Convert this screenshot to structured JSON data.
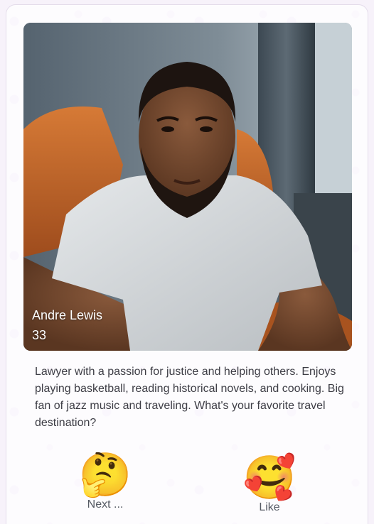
{
  "profile": {
    "name": "Andre Lewis",
    "age": "33",
    "bio": "Lawyer with a passion for justice and helping others. Enjoys playing basketball, reading historical novels, and cooking. Big fan of jazz music and traveling. What's your favorite travel destination?"
  },
  "actions": {
    "next": {
      "emoji": "🤔",
      "label": "Next ...",
      "icon": "thinking-face-icon"
    },
    "like": {
      "emoji": "🥰",
      "label": "Like",
      "icon": "smiling-face-with-hearts-icon"
    }
  },
  "colors": {
    "background": "#f7f2fa",
    "card": "#ffffff",
    "text": "#3d3d45",
    "chair": "#c8692a",
    "shirt": "#d9dcde"
  }
}
